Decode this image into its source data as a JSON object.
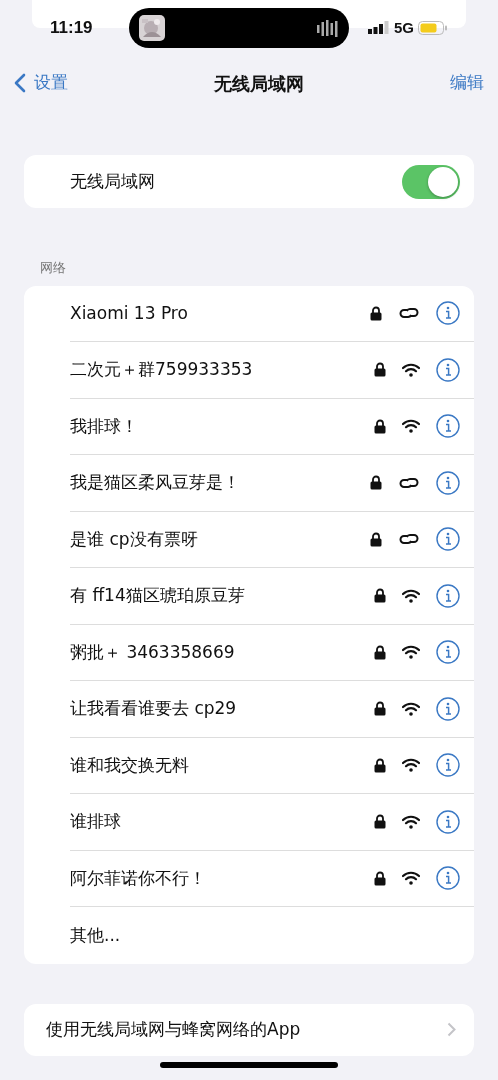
{
  "status_bar": {
    "time": "11:19",
    "network": "5G"
  },
  "nav": {
    "back": "设置",
    "title": "无线局域网",
    "edit": "编辑"
  },
  "wifi_toggle": {
    "label": "无线局域网",
    "on": true
  },
  "section_title": "网络",
  "networks": [
    {
      "name": "Xiaomi 13 Pro",
      "kind": "link"
    },
    {
      "name": "二次元＋群759933353",
      "kind": "wifi"
    },
    {
      "name": "我排球！",
      "kind": "wifi"
    },
    {
      "name": "我是猫区柔风豆芽是！",
      "kind": "link"
    },
    {
      "name": "是谁 cp没有票呀",
      "kind": "link"
    },
    {
      "name": "有 ff14猫区琥珀原豆芽",
      "kind": "wifi"
    },
    {
      "name": "粥批＋ 3463358669",
      "kind": "wifi"
    },
    {
      "name": "让我看看谁要去 cp29",
      "kind": "wifi"
    },
    {
      "name": "谁和我交换无料",
      "kind": "wifi"
    },
    {
      "name": "谁排球",
      "kind": "wifi"
    },
    {
      "name": "阿尔菲诺你不行！",
      "kind": "wifi"
    }
  ],
  "other": "其他...",
  "apps_row": "使用无线局域网与蜂窝网络的App"
}
